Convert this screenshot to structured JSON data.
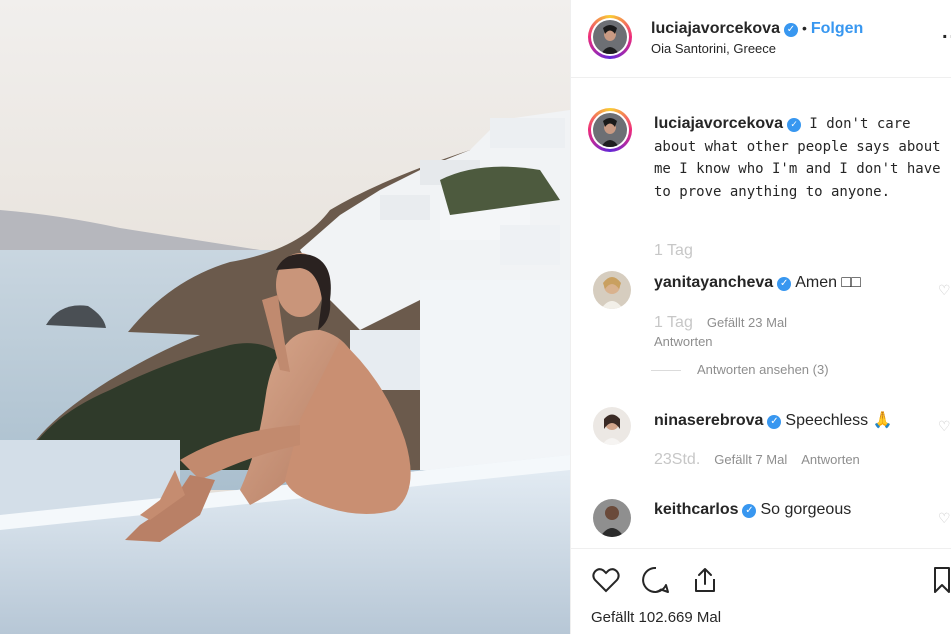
{
  "post": {
    "username": "luciajavorcekova",
    "dot": "•",
    "follow_label": "Folgen",
    "location": "Oia Santorini, Greece",
    "more_label": "...",
    "verified_mark": "✓"
  },
  "caption": {
    "username": "luciajavorcekova",
    "text": "I don't care about what other people says about me I know who I'm and I don't have to prove anything to anyone.",
    "time": "1 Tag"
  },
  "comments": [
    {
      "username": "yanitayancheva",
      "text": "Amen □□",
      "time": "1 Tag",
      "likes": "Gefällt 23 Mal",
      "reply": "Antworten",
      "view_replies": "Antworten ansehen (3)"
    },
    {
      "username": "ninaserebrova",
      "text": "Speechless 🙏",
      "time": "23Std.",
      "likes": "Gefällt 7 Mal",
      "reply": "Antworten"
    },
    {
      "username": "keithcarlos",
      "text": "So gorgeous"
    }
  ],
  "footer": {
    "likes_text": "Gefällt 102.669 Mal"
  },
  "icons": [
    "heart-icon",
    "comment-icon",
    "share-icon",
    "bookmark-icon",
    "verified-icon",
    "more-icon"
  ],
  "colors": {
    "accent": "#3897f0",
    "text": "#262626",
    "muted": "#8e8e8e"
  }
}
